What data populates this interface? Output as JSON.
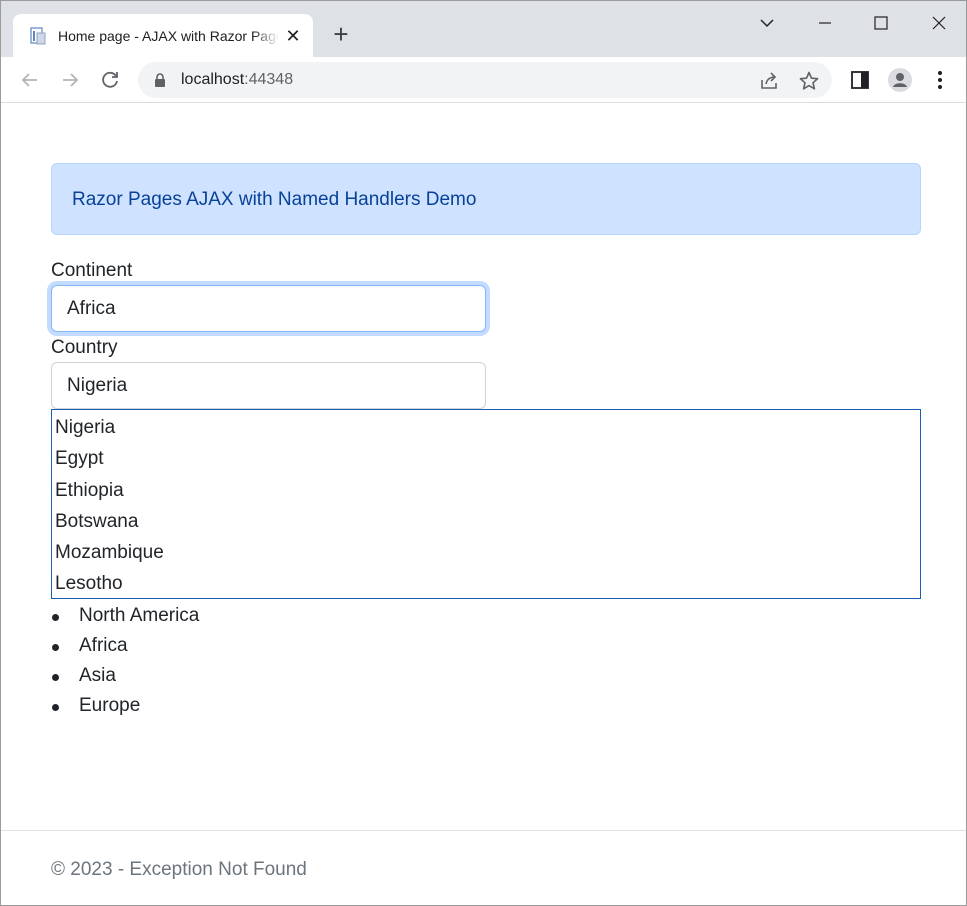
{
  "browser": {
    "tab_title": "Home page - AJAX with Razor Pages",
    "tab_close": "✕",
    "new_tab": "+",
    "url_host": "localhost",
    "url_port": ":44348",
    "icons": [
      "favicon-icon",
      "chevron-down-icon",
      "minimize-icon",
      "maximize-icon",
      "close-icon",
      "back-icon",
      "forward-icon",
      "reload-icon",
      "lock-icon",
      "share-icon",
      "star-icon",
      "side-panel-icon",
      "profile-icon",
      "menu-icon"
    ]
  },
  "page": {
    "alert_text": "Razor Pages AJAX with Named Handlers Demo",
    "continent_label": "Continent",
    "continent_value": "Africa",
    "country_label": "Country",
    "country_value": "Nigeria",
    "country_options": [
      "Nigeria",
      "Egypt",
      "Ethiopia",
      "Botswana",
      "Mozambique",
      "Lesotho"
    ],
    "continents_list": [
      "North America",
      "Africa",
      "Asia",
      "Europe"
    ],
    "footer": "© 2023 - Exception Not Found"
  },
  "colors": {
    "alert_bg": "#cfe2ff",
    "alert_text": "#084298",
    "focus_border": "#86b7fe",
    "dropdown_border": "#1a5fb4"
  }
}
